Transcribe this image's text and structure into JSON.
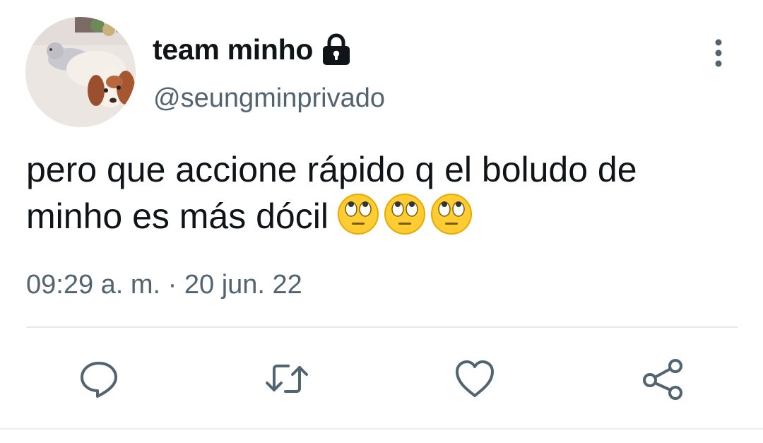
{
  "author": {
    "display_name": "team minho",
    "handle": "@seungminprivado",
    "protected": true,
    "avatar": "avatar-dog-photo"
  },
  "tweet": {
    "text_line1": "pero que accione rápido q el boludo de",
    "text_line2": "minho es más dócil",
    "emojis": [
      "face-with-rolling-eyes",
      "face-with-rolling-eyes",
      "face-with-rolling-eyes"
    ],
    "timestamp": "09:29 a. m. · 20 jun. 22"
  },
  "actions": [
    "reply-icon",
    "retweet-icon",
    "like-icon",
    "share-icon"
  ],
  "colors": {
    "text": "#0f1419",
    "secondary": "#536471",
    "icon": "#536471",
    "divider": "#e6e9ec",
    "emoji_face": "#ffcc33"
  }
}
